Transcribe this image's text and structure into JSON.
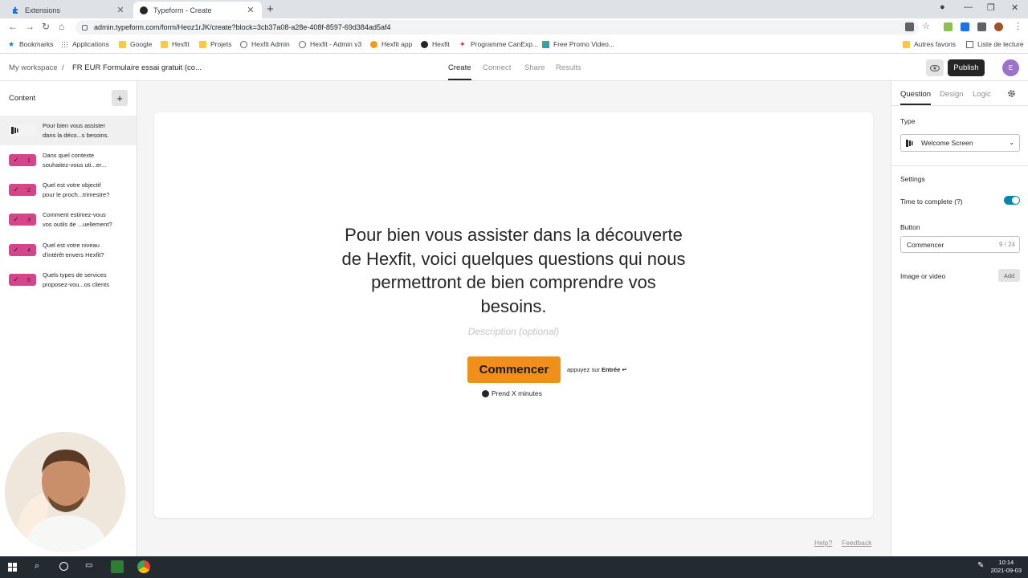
{
  "browser": {
    "tabs": [
      {
        "title": "Extensions",
        "active": false
      },
      {
        "title": "Typeform - Create",
        "active": true
      }
    ],
    "url": "admin.typeform.com/form/Heoz1rJK/create?block=3cb37a08-a28e-408f-8597-69d384ad5af4",
    "bookmarks": [
      "Bookmarks",
      "Applications",
      "Google",
      "Hexfit",
      "Projets",
      "Hexfit Admin",
      "Hexfit - Admin v3",
      "Hexfit app",
      "Hexfit",
      "Programme CanExp...",
      "Free Promo Video..."
    ],
    "bookmarks_right": [
      "Autres favoris",
      "Liste de lecture"
    ]
  },
  "header": {
    "workspace": "My workspace",
    "separator": "/",
    "form_name": "FR  EUR Formulaire essai gratuit (co...",
    "nav": [
      "Create",
      "Connect",
      "Share",
      "Results"
    ],
    "publish": "Publish",
    "avatar_letter": "E"
  },
  "sidebar": {
    "title": "Content",
    "add": "+",
    "items": [
      {
        "badge": "",
        "line1": "Pour bien vous assister",
        "line2": "dans la déco...s besoins."
      },
      {
        "badge": "1",
        "line1": "Dans quel contexte",
        "line2": "souhaitez-vous uti...er..."
      },
      {
        "badge": "2",
        "line1": "Quel est votre objectif",
        "line2": "pour le proch...trimestre?"
      },
      {
        "badge": "3",
        "line1": "Comment estimez-vous",
        "line2": "vos outils de ...uellement?"
      },
      {
        "badge": "4",
        "line1": "Quel est votre niveau",
        "line2": "d'intérêt envers Hexfit?"
      },
      {
        "badge": "5",
        "line1": "Quels types de services",
        "line2": "proposez-vou...os clients"
      }
    ]
  },
  "canvas": {
    "title_lines": [
      "Pour bien vous assister dans la découverte",
      "de Hexfit, voici quelques questions qui nous",
      "permettront de bien comprendre vos",
      "besoins."
    ],
    "description_placeholder": "Description (optional)",
    "button_label": "Commencer",
    "press_prefix": "appuyez sur",
    "press_key": "Entrée ↵",
    "time_hint": "Prend X minutes",
    "help": "Help?",
    "feedback": "Feedback"
  },
  "panel": {
    "tabs": [
      "Question",
      "Design",
      "Logic"
    ],
    "type_label": "Type",
    "type_value": "Welcome Screen",
    "settings_label": "Settings",
    "time_to_complete": "Time to complete (?)",
    "button_label": "Button",
    "button_value": "Commencer",
    "button_count": "9 / 24",
    "media_label": "Image or video",
    "media_add": "Add"
  },
  "taskbar": {
    "time": "10:14",
    "date": "2021-09-03"
  },
  "colors": {
    "accent_orange": "#f18f1b",
    "badge_pink": "#d6458a",
    "toggle_teal": "#0487af",
    "avatar_purple": "#9b73c9"
  }
}
